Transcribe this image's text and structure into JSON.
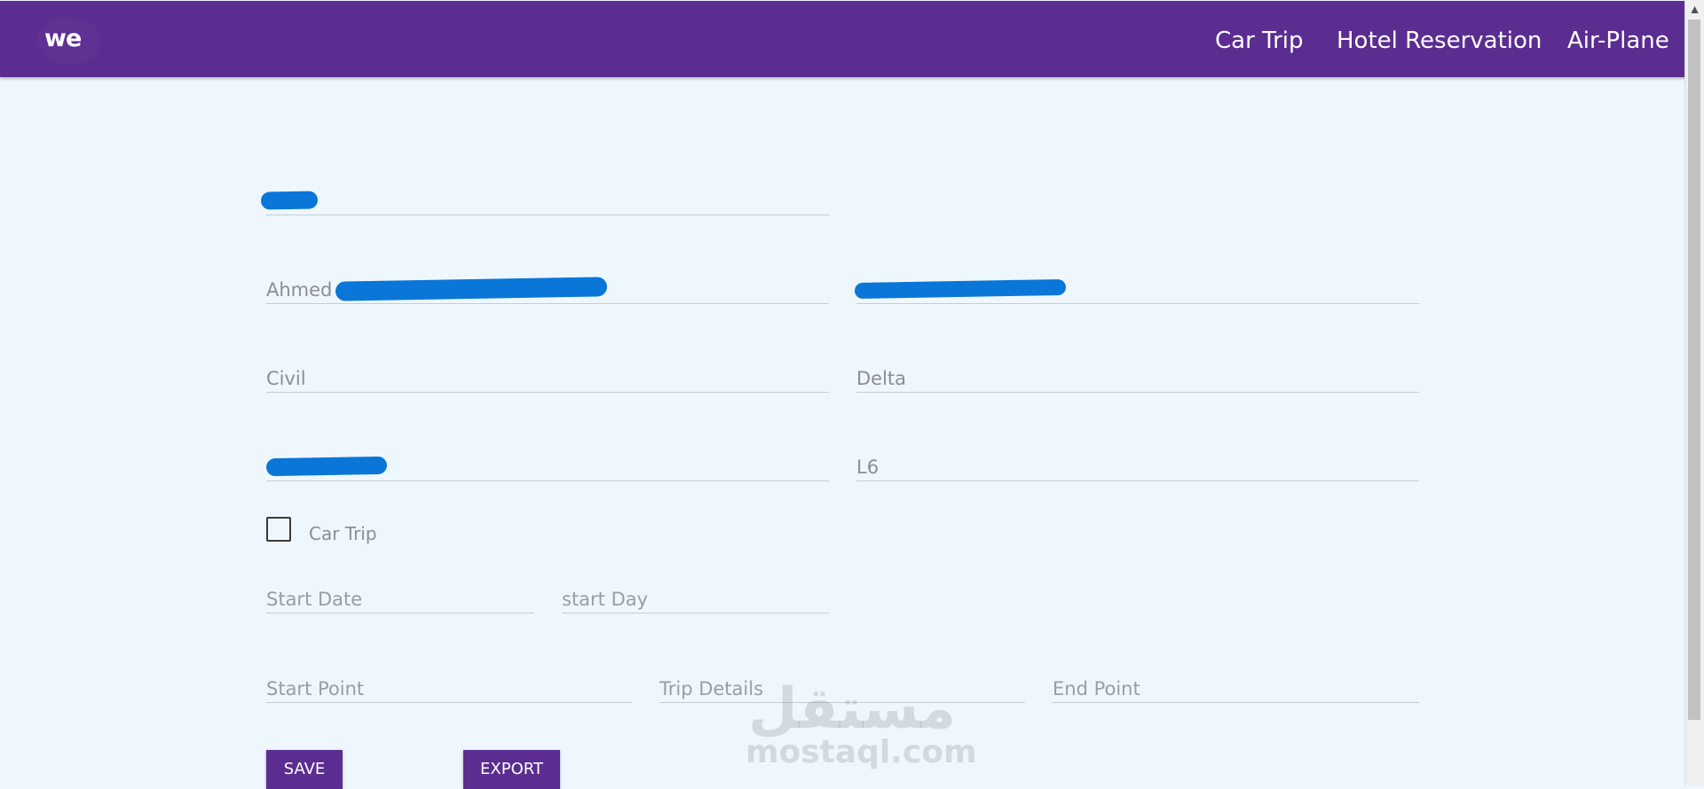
{
  "navbar": {
    "logo_text": "we",
    "links": [
      "Car Trip",
      "Hotel Reservation",
      "Air-Plane"
    ],
    "background": "#5b2d91"
  },
  "form": {
    "name_value": "Ahmed S",
    "field3_left": "Civil",
    "field3_right": "Delta",
    "field4_right": "L6",
    "checkbox_label": "Car Trip",
    "start_date_placeholder": "Start Date",
    "start_day_placeholder": "start Day",
    "start_point_placeholder": "Start Point",
    "trip_details_placeholder": "Trip Details",
    "end_point_placeholder": "End Point"
  },
  "buttons": {
    "save": "SAVE",
    "export": "EXPORT"
  },
  "watermark": {
    "arabic": "مستقل",
    "latin": "mostaql.com"
  }
}
